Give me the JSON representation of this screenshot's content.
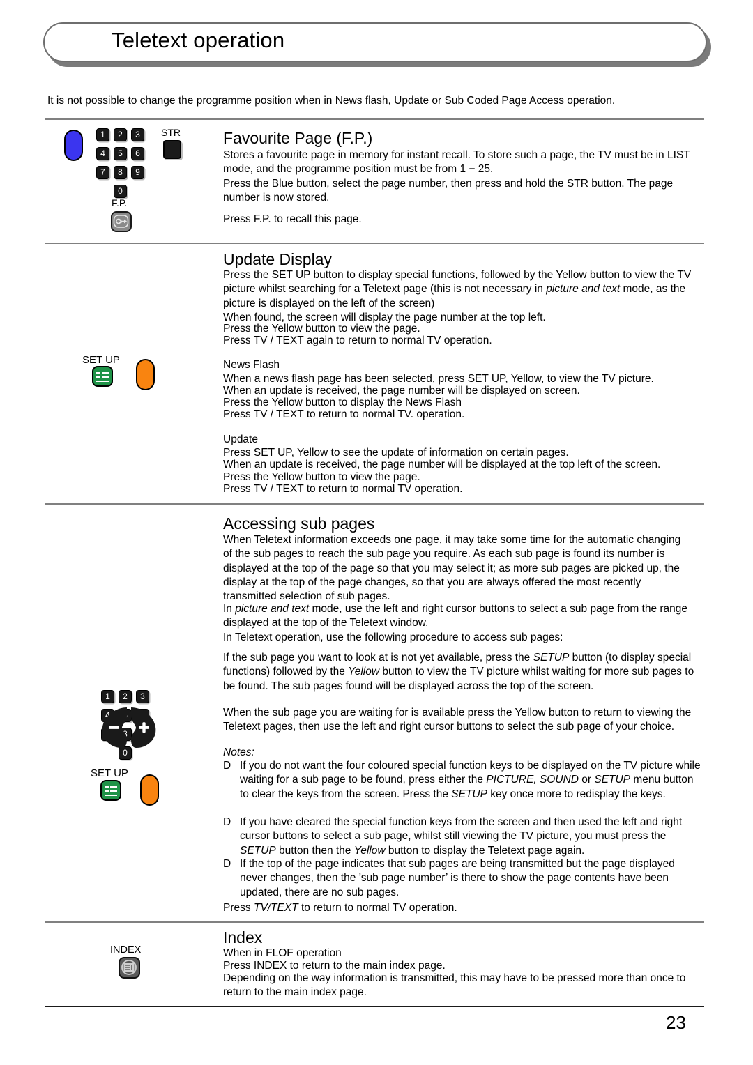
{
  "header": {
    "title": "Teletext operation"
  },
  "intro": "It is not possible to change the programme position when in News flash, Update or Sub Coded Page Access operation.",
  "icons": {
    "blue_pill": "blue-button",
    "orange_pill": "orange-button",
    "str_label": "STR",
    "fp_label": "F.P.",
    "setup_label": "SET UP",
    "index_label": "INDEX",
    "keypad_keys": [
      "1",
      "2",
      "3",
      "4",
      "5",
      "6",
      "7",
      "8",
      "9",
      "0"
    ],
    "cursor_minus": "−",
    "cursor_plus": "+"
  },
  "sections": {
    "favourite_page": {
      "title": "Favourite Page (F.P.)",
      "para1": "Stores a favourite page in memory for instant recall. To store such a page, the TV must be in LIST mode, and the programme position must be from 1 − 25.",
      "para2": "Press the Blue button, select the page number, then press and hold the STR button. The page number is now stored.",
      "para3": "Press F.P. to recall this page."
    },
    "update_display": {
      "title": "Update Display",
      "line1a": "Press the SET UP button to display special functions, followed by the Yellow button to view the TV picture whilst searching for a Teletext page (this is not necessary in ",
      "line1b": "picture and text",
      "line1c": " mode, as the picture is displayed on the left of the screen)",
      "line2": "When found, the screen will display the page number at the top left.",
      "line3": "Press the Yellow button to view the page.",
      "line4": "Press TV / TEXT again to return to normal TV operation.",
      "newsflash_head": "News Flash",
      "newsflash_l1": "When a news flash page has been selected, press SET UP, Yellow, to view the TV picture.",
      "newsflash_l2": "When an update is received, the page number will be displayed on screen.",
      "newsflash_l3": "Press the Yellow button to display the News Flash",
      "newsflash_l4": "Press TV / TEXT to return to normal TV. operation.",
      "update_head": "Update",
      "update_l1": "Press SET UP, Yellow to see the update of information on certain pages.",
      "update_l2": "When an update is received, the page number will be displayed at the top left of the screen.",
      "update_l3": "Press the Yellow button to view the page.",
      "update_l4": "Press TV / TEXT to return to normal TV operation."
    },
    "accessing_sub_pages": {
      "title": "Accessing sub pages",
      "para1": "When Teletext information exceeds one page, it may take some time for the automatic changing of the sub pages to reach the sub page you require. As each sub page is found its number is displayed at the top of the page so that you may select it; as more sub pages are picked up, the display at the top of the page changes, so that you are always offered the most recently transmitted selection of sub pages.",
      "para2a": "In ",
      "para2b": "picture and text",
      "para2c": " mode, use the left and right cursor buttons to select a sub page from the range displayed at the top of the Teletext window.",
      "para3": "In Teletext operation, use the following procedure to access sub pages:",
      "para4a": "If the sub page you want to look at is not yet available, press the ",
      "para4b": "SETUP",
      "para4c": " button (to display special functions) followed by the ",
      "para4d": "Yellow",
      "para4e": " button to view the TV picture whilst waiting for more sub pages to be found. The sub pages found will be displayed across the top of the screen.",
      "para5": "When the sub page you are waiting for is available press the Yellow button to return to viewing the Teletext pages, then use the left and right cursor buttons to select the sub page of your choice.",
      "notes_head": "Notes:",
      "note_marker": "D",
      "note1a": "If you do not want the four coloured special function keys to be displayed on the TV picture while waiting for a sub page to be found, press either the ",
      "note1b": "PICTURE, SOUND",
      "note1c": " or ",
      "note1d": "SETUP",
      "note1e": " menu button to clear the keys from the screen. Press the ",
      "note1f": "SETUP",
      "note1g": " key once more to redisplay the keys.",
      "note2a": "If you have cleared the special function keys from the screen and then used the left and right cursor buttons to select a sub page, whilst still viewing the TV picture, you must press the ",
      "note2b": "SETUP",
      "note2c": " button then the ",
      "note2d": "Yellow",
      "note2e": " button to display the Teletext page again.",
      "note3": "If the top of the page indicates that sub pages are being transmitted but the page displayed never changes, then the ’sub page number’ is there to show the page contents have been updated, there are no sub pages.",
      "closing_a": "Press ",
      "closing_b": "TV/TEXT",
      "closing_c": " to return to normal TV operation."
    },
    "index": {
      "title": "Index",
      "line1": "When in FLOF operation",
      "line2": "Press INDEX to return to the main index page.",
      "line3": "Depending on the way information is transmitted, this may have to be pressed more than once to return to the main index page."
    }
  },
  "footer": {
    "page_number": "23"
  }
}
